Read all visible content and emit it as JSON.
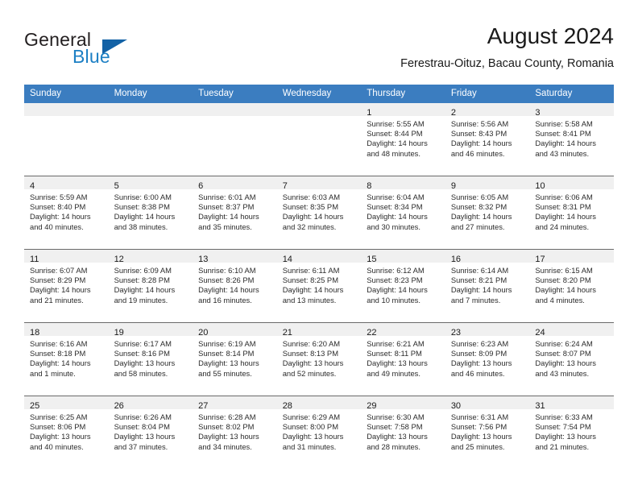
{
  "brand": {
    "word1": "General",
    "word2": "Blue",
    "logo_icon": "triangle-logo-icon",
    "accent_color": "#1c7fc4"
  },
  "header": {
    "month_title": "August 2024",
    "location": "Ferestrau-Oituz, Bacau County, Romania"
  },
  "calendar": {
    "header_color": "#3b7dc0",
    "weekday_headers": [
      "Sunday",
      "Monday",
      "Tuesday",
      "Wednesday",
      "Thursday",
      "Friday",
      "Saturday"
    ],
    "weeks": [
      [
        {
          "empty": true,
          "day": "",
          "sunrise": "",
          "sunset": "",
          "daylight1": "",
          "daylight2": ""
        },
        {
          "empty": true,
          "day": "",
          "sunrise": "",
          "sunset": "",
          "daylight1": "",
          "daylight2": ""
        },
        {
          "empty": true,
          "day": "",
          "sunrise": "",
          "sunset": "",
          "daylight1": "",
          "daylight2": ""
        },
        {
          "empty": true,
          "day": "",
          "sunrise": "",
          "sunset": "",
          "daylight1": "",
          "daylight2": ""
        },
        {
          "empty": false,
          "day": "1",
          "sunrise": "Sunrise: 5:55 AM",
          "sunset": "Sunset: 8:44 PM",
          "daylight1": "Daylight: 14 hours",
          "daylight2": "and 48 minutes."
        },
        {
          "empty": false,
          "day": "2",
          "sunrise": "Sunrise: 5:56 AM",
          "sunset": "Sunset: 8:43 PM",
          "daylight1": "Daylight: 14 hours",
          "daylight2": "and 46 minutes."
        },
        {
          "empty": false,
          "day": "3",
          "sunrise": "Sunrise: 5:58 AM",
          "sunset": "Sunset: 8:41 PM",
          "daylight1": "Daylight: 14 hours",
          "daylight2": "and 43 minutes."
        }
      ],
      [
        {
          "empty": false,
          "day": "4",
          "sunrise": "Sunrise: 5:59 AM",
          "sunset": "Sunset: 8:40 PM",
          "daylight1": "Daylight: 14 hours",
          "daylight2": "and 40 minutes."
        },
        {
          "empty": false,
          "day": "5",
          "sunrise": "Sunrise: 6:00 AM",
          "sunset": "Sunset: 8:38 PM",
          "daylight1": "Daylight: 14 hours",
          "daylight2": "and 38 minutes."
        },
        {
          "empty": false,
          "day": "6",
          "sunrise": "Sunrise: 6:01 AM",
          "sunset": "Sunset: 8:37 PM",
          "daylight1": "Daylight: 14 hours",
          "daylight2": "and 35 minutes."
        },
        {
          "empty": false,
          "day": "7",
          "sunrise": "Sunrise: 6:03 AM",
          "sunset": "Sunset: 8:35 PM",
          "daylight1": "Daylight: 14 hours",
          "daylight2": "and 32 minutes."
        },
        {
          "empty": false,
          "day": "8",
          "sunrise": "Sunrise: 6:04 AM",
          "sunset": "Sunset: 8:34 PM",
          "daylight1": "Daylight: 14 hours",
          "daylight2": "and 30 minutes."
        },
        {
          "empty": false,
          "day": "9",
          "sunrise": "Sunrise: 6:05 AM",
          "sunset": "Sunset: 8:32 PM",
          "daylight1": "Daylight: 14 hours",
          "daylight2": "and 27 minutes."
        },
        {
          "empty": false,
          "day": "10",
          "sunrise": "Sunrise: 6:06 AM",
          "sunset": "Sunset: 8:31 PM",
          "daylight1": "Daylight: 14 hours",
          "daylight2": "and 24 minutes."
        }
      ],
      [
        {
          "empty": false,
          "day": "11",
          "sunrise": "Sunrise: 6:07 AM",
          "sunset": "Sunset: 8:29 PM",
          "daylight1": "Daylight: 14 hours",
          "daylight2": "and 21 minutes."
        },
        {
          "empty": false,
          "day": "12",
          "sunrise": "Sunrise: 6:09 AM",
          "sunset": "Sunset: 8:28 PM",
          "daylight1": "Daylight: 14 hours",
          "daylight2": "and 19 minutes."
        },
        {
          "empty": false,
          "day": "13",
          "sunrise": "Sunrise: 6:10 AM",
          "sunset": "Sunset: 8:26 PM",
          "daylight1": "Daylight: 14 hours",
          "daylight2": "and 16 minutes."
        },
        {
          "empty": false,
          "day": "14",
          "sunrise": "Sunrise: 6:11 AM",
          "sunset": "Sunset: 8:25 PM",
          "daylight1": "Daylight: 14 hours",
          "daylight2": "and 13 minutes."
        },
        {
          "empty": false,
          "day": "15",
          "sunrise": "Sunrise: 6:12 AM",
          "sunset": "Sunset: 8:23 PM",
          "daylight1": "Daylight: 14 hours",
          "daylight2": "and 10 minutes."
        },
        {
          "empty": false,
          "day": "16",
          "sunrise": "Sunrise: 6:14 AM",
          "sunset": "Sunset: 8:21 PM",
          "daylight1": "Daylight: 14 hours",
          "daylight2": "and 7 minutes."
        },
        {
          "empty": false,
          "day": "17",
          "sunrise": "Sunrise: 6:15 AM",
          "sunset": "Sunset: 8:20 PM",
          "daylight1": "Daylight: 14 hours",
          "daylight2": "and 4 minutes."
        }
      ],
      [
        {
          "empty": false,
          "day": "18",
          "sunrise": "Sunrise: 6:16 AM",
          "sunset": "Sunset: 8:18 PM",
          "daylight1": "Daylight: 14 hours",
          "daylight2": "and 1 minute."
        },
        {
          "empty": false,
          "day": "19",
          "sunrise": "Sunrise: 6:17 AM",
          "sunset": "Sunset: 8:16 PM",
          "daylight1": "Daylight: 13 hours",
          "daylight2": "and 58 minutes."
        },
        {
          "empty": false,
          "day": "20",
          "sunrise": "Sunrise: 6:19 AM",
          "sunset": "Sunset: 8:14 PM",
          "daylight1": "Daylight: 13 hours",
          "daylight2": "and 55 minutes."
        },
        {
          "empty": false,
          "day": "21",
          "sunrise": "Sunrise: 6:20 AM",
          "sunset": "Sunset: 8:13 PM",
          "daylight1": "Daylight: 13 hours",
          "daylight2": "and 52 minutes."
        },
        {
          "empty": false,
          "day": "22",
          "sunrise": "Sunrise: 6:21 AM",
          "sunset": "Sunset: 8:11 PM",
          "daylight1": "Daylight: 13 hours",
          "daylight2": "and 49 minutes."
        },
        {
          "empty": false,
          "day": "23",
          "sunrise": "Sunrise: 6:23 AM",
          "sunset": "Sunset: 8:09 PM",
          "daylight1": "Daylight: 13 hours",
          "daylight2": "and 46 minutes."
        },
        {
          "empty": false,
          "day": "24",
          "sunrise": "Sunrise: 6:24 AM",
          "sunset": "Sunset: 8:07 PM",
          "daylight1": "Daylight: 13 hours",
          "daylight2": "and 43 minutes."
        }
      ],
      [
        {
          "empty": false,
          "day": "25",
          "sunrise": "Sunrise: 6:25 AM",
          "sunset": "Sunset: 8:06 PM",
          "daylight1": "Daylight: 13 hours",
          "daylight2": "and 40 minutes."
        },
        {
          "empty": false,
          "day": "26",
          "sunrise": "Sunrise: 6:26 AM",
          "sunset": "Sunset: 8:04 PM",
          "daylight1": "Daylight: 13 hours",
          "daylight2": "and 37 minutes."
        },
        {
          "empty": false,
          "day": "27",
          "sunrise": "Sunrise: 6:28 AM",
          "sunset": "Sunset: 8:02 PM",
          "daylight1": "Daylight: 13 hours",
          "daylight2": "and 34 minutes."
        },
        {
          "empty": false,
          "day": "28",
          "sunrise": "Sunrise: 6:29 AM",
          "sunset": "Sunset: 8:00 PM",
          "daylight1": "Daylight: 13 hours",
          "daylight2": "and 31 minutes."
        },
        {
          "empty": false,
          "day": "29",
          "sunrise": "Sunrise: 6:30 AM",
          "sunset": "Sunset: 7:58 PM",
          "daylight1": "Daylight: 13 hours",
          "daylight2": "and 28 minutes."
        },
        {
          "empty": false,
          "day": "30",
          "sunrise": "Sunrise: 6:31 AM",
          "sunset": "Sunset: 7:56 PM",
          "daylight1": "Daylight: 13 hours",
          "daylight2": "and 25 minutes."
        },
        {
          "empty": false,
          "day": "31",
          "sunrise": "Sunrise: 6:33 AM",
          "sunset": "Sunset: 7:54 PM",
          "daylight1": "Daylight: 13 hours",
          "daylight2": "and 21 minutes."
        }
      ]
    ]
  }
}
